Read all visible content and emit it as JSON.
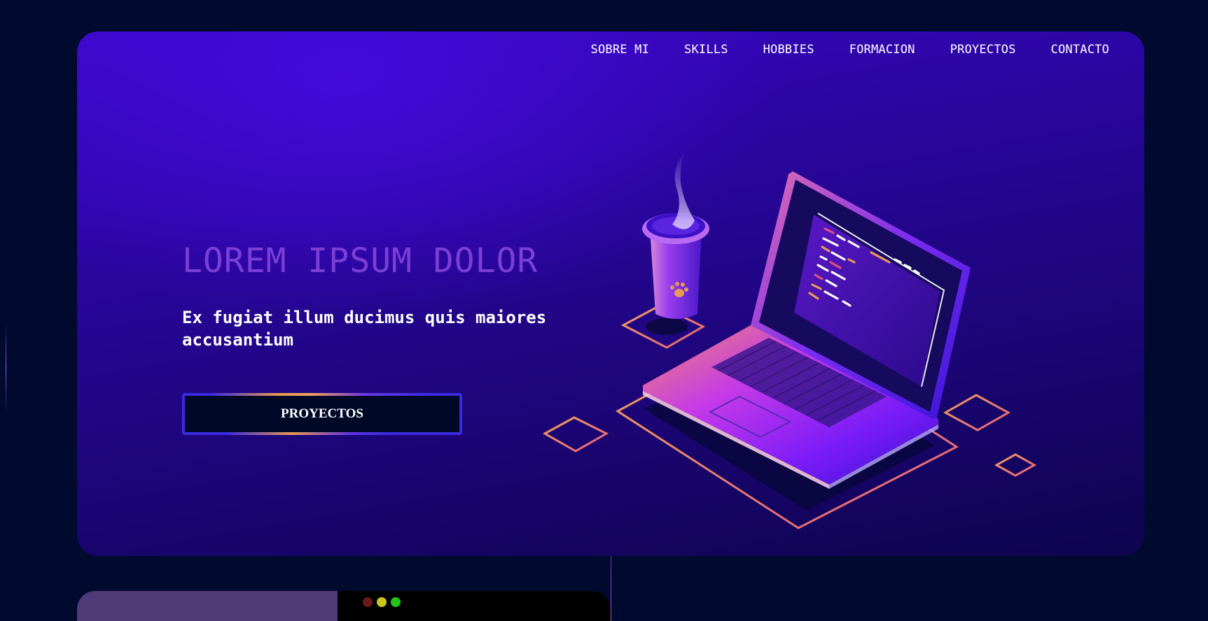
{
  "nav": {
    "items": [
      {
        "label": "SOBRE MI"
      },
      {
        "label": "SKILLS"
      },
      {
        "label": "HOBBIES"
      },
      {
        "label": "FORMACION"
      },
      {
        "label": "PROYECTOS"
      },
      {
        "label": "CONTACTO"
      }
    ]
  },
  "hero": {
    "title": "LOREM IPSUM DOLOR",
    "subtitle": "Ex fugiat illum ducimus quis maiores accusantium",
    "cta_label": "PROYECTOS",
    "illustration_icon": "laptop-coffee-illustration"
  },
  "window_dots": {
    "colors": [
      "#6a1a1a",
      "#c8c81a",
      "#22c41c"
    ]
  },
  "colors": {
    "background": "#000a2e",
    "hero_gradient_top": "#3a06c8",
    "hero_gradient_bottom": "#0e044e",
    "title": "#7b3fd6",
    "accent_orange": "#e89a50",
    "accent_border": "#3a2be0",
    "card_left": "#503a78",
    "card_right": "#000000"
  }
}
